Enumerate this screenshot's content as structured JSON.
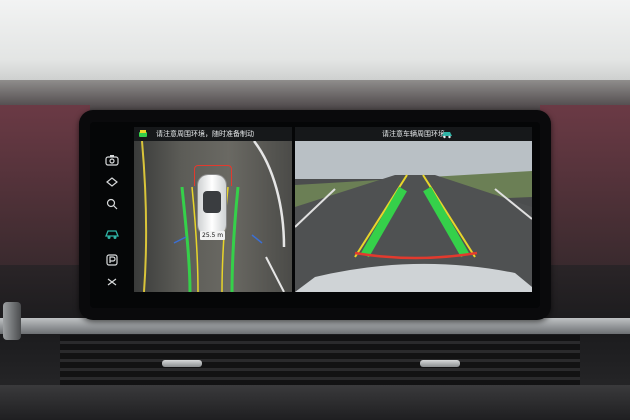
{
  "left_panel": {
    "header_text": "请注意周围环境，随时准备制动",
    "distance_badge": "25.5 m"
  },
  "right_panel": {
    "header_text": "请注意车辆周围环境"
  },
  "side_menu": {
    "items": [
      {
        "icon": "camera-settings-icon",
        "active": false
      },
      {
        "icon": "view-toggle-icon",
        "active": false
      },
      {
        "icon": "zoom-icon",
        "active": false
      },
      {
        "icon": "car-view-icon",
        "active": true
      },
      {
        "icon": "parking-icon",
        "active": false
      },
      {
        "icon": "return-icon",
        "active": false
      }
    ]
  },
  "colors": {
    "guide_green": "#35d04a",
    "guide_yellow": "#e8d52a",
    "guide_red": "#e23a2e",
    "active_teal": "#2fb4a6"
  }
}
